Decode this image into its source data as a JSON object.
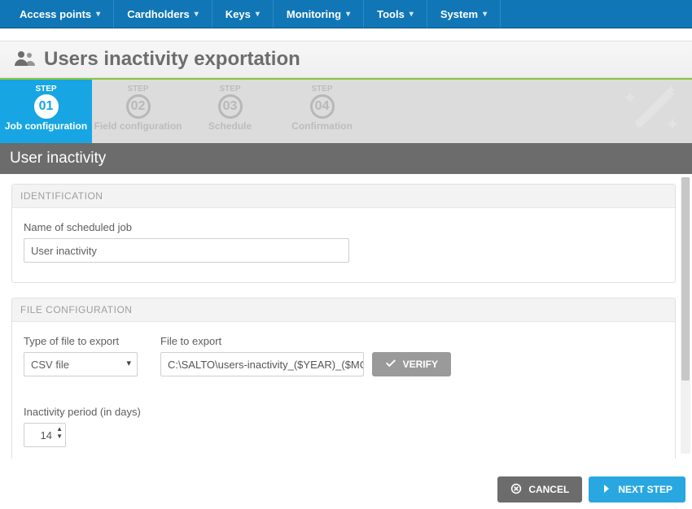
{
  "menu": {
    "items": [
      {
        "label": "Access points"
      },
      {
        "label": "Cardholders"
      },
      {
        "label": "Keys"
      },
      {
        "label": "Monitoring"
      },
      {
        "label": "Tools"
      },
      {
        "label": "System"
      }
    ]
  },
  "title": "Users inactivity exportation",
  "wizard": {
    "step_label": "STEP",
    "steps": [
      {
        "num": "01",
        "name": "Job configuration",
        "active": true
      },
      {
        "num": "02",
        "name": "Field configuration",
        "active": false
      },
      {
        "num": "03",
        "name": "Schedule",
        "active": false
      },
      {
        "num": "04",
        "name": "Confirmation",
        "active": false
      }
    ]
  },
  "subheader": "User inactivity",
  "identification": {
    "panel_title": "IDENTIFICATION",
    "name_label": "Name of scheduled job",
    "name_value": "User inactivity"
  },
  "file_cfg": {
    "panel_title": "FILE CONFIGURATION",
    "type_label": "Type of file to export",
    "type_value": "CSV file",
    "file_label": "File to export",
    "file_value": "C:\\SALTO\\users-inactivity_($YEAR)_($MONTH)_($D",
    "verify_label": "VERIFY",
    "inactivity_label": "Inactivity period (in days)",
    "inactivity_value": "14"
  },
  "footer": {
    "cancel": "CANCEL",
    "next": "NEXT STEP"
  }
}
